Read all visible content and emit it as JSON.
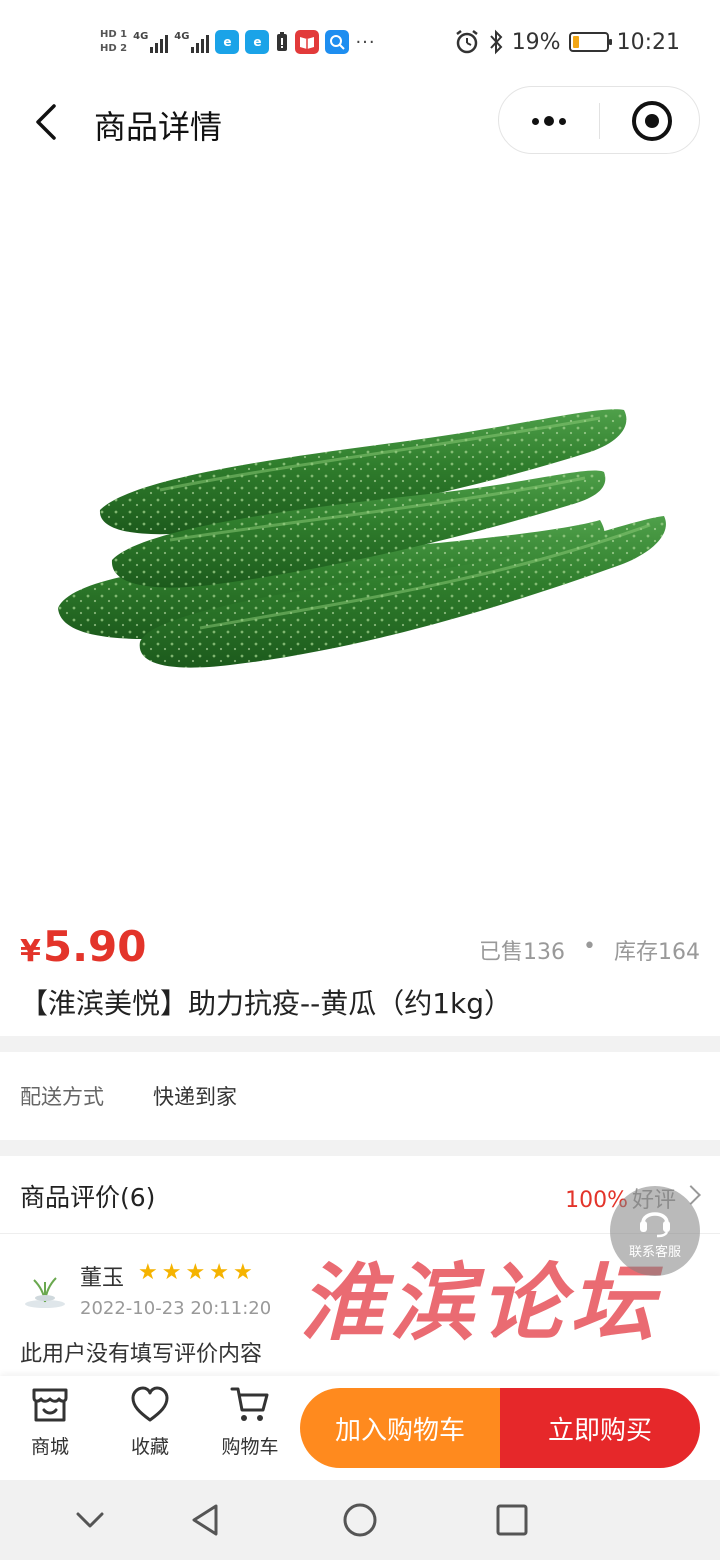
{
  "status_bar": {
    "hd1": "HD 1",
    "hd2": "HD 2",
    "net1": "4G",
    "net2": "4G",
    "battery_pct": "19%",
    "battery_level": 0.19,
    "time": "10:21",
    "more": "···"
  },
  "nav": {
    "title": "商品详情"
  },
  "product": {
    "currency": "¥",
    "price": "5.90",
    "sold": "已售136",
    "dot": "•",
    "stock": "库存164",
    "title": "【淮滨美悦】助力抗疫--黄瓜（约1kg）"
  },
  "delivery": {
    "label": "配送方式",
    "value": "快递到家"
  },
  "reviews": {
    "title": "商品评价(6)",
    "rate_pct": "100%",
    "rate_text": "好评",
    "items": [
      {
        "name": "董玉",
        "stars": 5,
        "date": "2022-10-23 20:11:20",
        "text": "此用户没有填写评价内容"
      }
    ]
  },
  "watermark": "淮滨论坛",
  "customer_service": {
    "label": "联系客服"
  },
  "bottom_bar": {
    "shop": "商城",
    "favorite": "收藏",
    "cart": "购物车",
    "add_to_cart": "加入购物车",
    "buy_now": "立即购买"
  },
  "colors": {
    "price": "#e3342a",
    "add_to_cart": "#ff8a1e",
    "buy_now": "#e6282a",
    "star": "#f5b300"
  }
}
